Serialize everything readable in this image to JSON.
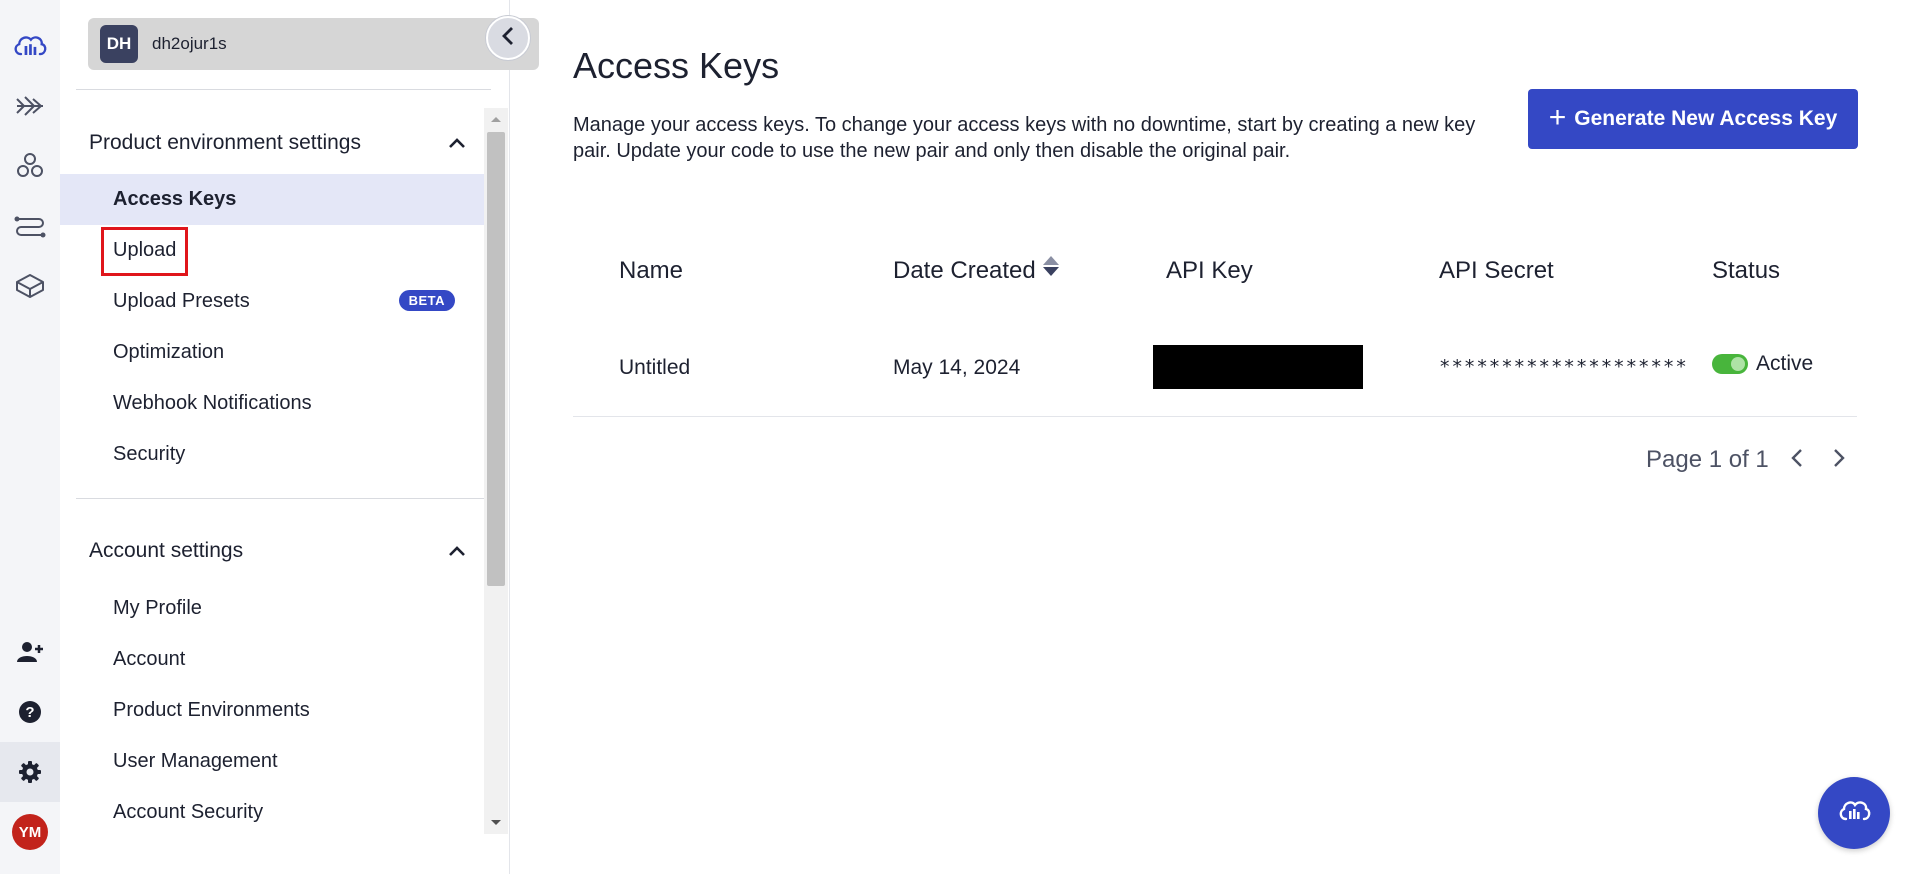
{
  "rail": {
    "top_icons": [
      "cloudinary-logo-icon",
      "media-flows-icon",
      "integrations-icon",
      "routes-icon",
      "assets-cube-icon"
    ],
    "bottom_icons": [
      "add-user-icon",
      "help-icon",
      "settings-gear-icon"
    ],
    "user_avatar": "YM"
  },
  "environment": {
    "initials": "DH",
    "name": "dh2ojur1s"
  },
  "sidebar": {
    "sections": [
      {
        "title": "Product environment settings",
        "items": [
          {
            "label": "Access Keys",
            "active": true
          },
          {
            "label": "Upload",
            "highlighted": true
          },
          {
            "label": "Upload Presets",
            "badge": "BETA"
          },
          {
            "label": "Optimization"
          },
          {
            "label": "Webhook Notifications"
          },
          {
            "label": "Security"
          }
        ]
      },
      {
        "title": "Account settings",
        "items": [
          {
            "label": "My Profile"
          },
          {
            "label": "Account"
          },
          {
            "label": "Product Environments"
          },
          {
            "label": "User Management"
          },
          {
            "label": "Account Security"
          }
        ]
      }
    ]
  },
  "main": {
    "title": "Access Keys",
    "description": "Manage your access keys. To change your access keys with no downtime, start by creating a new key pair. Update your code to use the new pair and only then disable the original pair.",
    "generate_button": "Generate New Access Key",
    "table": {
      "columns": [
        "Name",
        "Date Created",
        "API Key",
        "API Secret",
        "Status"
      ],
      "rows": [
        {
          "name": "Untitled",
          "date_created": "May 14, 2024",
          "api_key": "",
          "api_secret": "********************",
          "status": "Active"
        }
      ]
    },
    "pagination": "Page 1 of 1"
  },
  "colors": {
    "accent": "#3448c5",
    "active_nav_bg": "#e4e7f7",
    "status_active": "#48b53c",
    "highlight": "#e0151b",
    "avatar_ym": "#c2231b"
  }
}
